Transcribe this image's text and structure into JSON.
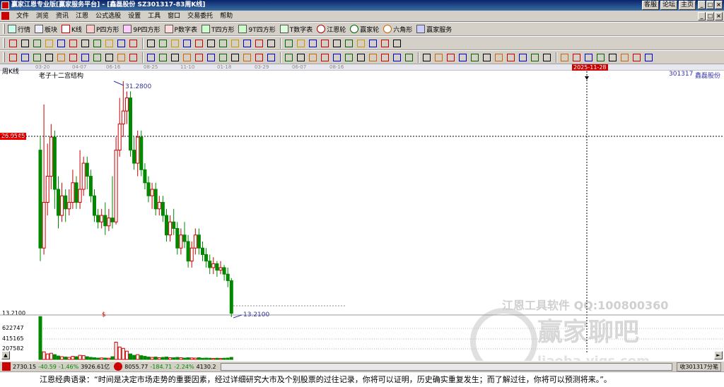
{
  "window": {
    "title": "赢家江恩专业版[赢家服务平台] - [鑫磊股份  SZ301317-83周K线]",
    "links": [
      "客服",
      "论坛",
      "主页"
    ]
  },
  "menu": [
    "文件",
    "浏览",
    "资讯",
    "江恩",
    "公式选股",
    "设置",
    "工具",
    "窗口",
    "交易委托",
    "帮助"
  ],
  "toolbar1": [
    "行情",
    "板块",
    "K线",
    "P四方形",
    "9P四方形",
    "P数字表",
    "T四方形",
    "9T四方形",
    "T数字表",
    "江恩轮",
    "赢家轮",
    "六角形",
    "赢家服务"
  ],
  "chart": {
    "period_label": "周K线",
    "structure_label": "老子十二宫结构",
    "code": "301317",
    "name": "鑫磊股份",
    "cursor_date": "2025-11-28",
    "cursor_price": "26.9545",
    "high_label": "31.2800",
    "low_label": "13.2100",
    "low_axis_label": "13.2100",
    "marker": "$",
    "top_dates": [
      "03-20",
      "04-07",
      "06-16",
      "08-25",
      "11-10",
      "01-18",
      "03-29",
      "06-07",
      "08-16"
    ],
    "vol_labels": [
      "622747",
      "415165",
      "207582"
    ],
    "candles": [
      {
        "o": 26,
        "c": 18.5,
        "h": 27,
        "l": 17.5
      },
      {
        "o": 18.5,
        "c": 22,
        "h": 29.5,
        "l": 18
      },
      {
        "o": 22,
        "c": 24,
        "h": 26.5,
        "l": 21
      },
      {
        "o": 24,
        "c": 27,
        "h": 28,
        "l": 23
      },
      {
        "o": 27,
        "c": 23,
        "h": 27.5,
        "l": 21.5
      },
      {
        "o": 23,
        "c": 21,
        "h": 24,
        "l": 20
      },
      {
        "o": 21,
        "c": 22.5,
        "h": 23.5,
        "l": 20.5
      },
      {
        "o": 22.5,
        "c": 21.5,
        "h": 23,
        "l": 20.5
      },
      {
        "o": 21.5,
        "c": 22,
        "h": 23,
        "l": 21
      },
      {
        "o": 22,
        "c": 23.5,
        "h": 24.5,
        "l": 21.5
      },
      {
        "o": 23.5,
        "c": 22,
        "h": 24,
        "l": 21.5
      },
      {
        "o": 22,
        "c": 23,
        "h": 26,
        "l": 21.5
      },
      {
        "o": 23,
        "c": 25,
        "h": 25.5,
        "l": 22.5
      },
      {
        "o": 25,
        "c": 24,
        "h": 25.5,
        "l": 23
      },
      {
        "o": 24,
        "c": 22.5,
        "h": 24.5,
        "l": 22
      },
      {
        "o": 22.5,
        "c": 21,
        "h": 23,
        "l": 20.5
      },
      {
        "o": 21,
        "c": 20.5,
        "h": 21.5,
        "l": 20
      },
      {
        "o": 20.5,
        "c": 21,
        "h": 21.5,
        "l": 20
      },
      {
        "o": 21,
        "c": 20.2,
        "h": 22,
        "l": 19.5
      },
      {
        "o": 20.2,
        "c": 20.8,
        "h": 21.5,
        "l": 19.8
      },
      {
        "o": 20.8,
        "c": 20.5,
        "h": 24,
        "l": 20
      },
      {
        "o": 20.5,
        "c": 26,
        "h": 27,
        "l": 20.3
      },
      {
        "o": 26,
        "c": 28,
        "h": 30,
        "l": 25.5
      },
      {
        "o": 28,
        "c": 29,
        "h": 31.28,
        "l": 27
      },
      {
        "o": 29,
        "c": 30,
        "h": 30.5,
        "l": 28
      },
      {
        "o": 30,
        "c": 26,
        "h": 30.5,
        "l": 25.5
      },
      {
        "o": 26,
        "c": 25,
        "h": 27,
        "l": 24.5
      },
      {
        "o": 25,
        "c": 27,
        "h": 27.5,
        "l": 24
      },
      {
        "o": 27,
        "c": 24.5,
        "h": 27.5,
        "l": 24
      },
      {
        "o": 24.5,
        "c": 23.5,
        "h": 25,
        "l": 23
      },
      {
        "o": 23.5,
        "c": 22.5,
        "h": 24,
        "l": 22
      },
      {
        "o": 22.5,
        "c": 23,
        "h": 23.5,
        "l": 21.5
      },
      {
        "o": 23,
        "c": 21.5,
        "h": 23.5,
        "l": 21
      },
      {
        "o": 21.5,
        "c": 22,
        "h": 22.5,
        "l": 21
      },
      {
        "o": 22,
        "c": 21,
        "h": 22.5,
        "l": 20.5
      },
      {
        "o": 21,
        "c": 19.5,
        "h": 21.5,
        "l": 19
      },
      {
        "o": 19.5,
        "c": 20.5,
        "h": 21,
        "l": 19
      },
      {
        "o": 20.5,
        "c": 20,
        "h": 21.5,
        "l": 19.5
      },
      {
        "o": 20,
        "c": 18.5,
        "h": 20.5,
        "l": 18
      },
      {
        "o": 18.5,
        "c": 19.5,
        "h": 20,
        "l": 18
      },
      {
        "o": 19.5,
        "c": 19,
        "h": 20.5,
        "l": 18.5
      },
      {
        "o": 19,
        "c": 17.5,
        "h": 19.5,
        "l": 17
      },
      {
        "o": 17.5,
        "c": 18.5,
        "h": 19,
        "l": 17
      },
      {
        "o": 18.5,
        "c": 19.5,
        "h": 20,
        "l": 18
      },
      {
        "o": 19.5,
        "c": 18.5,
        "h": 20,
        "l": 18
      },
      {
        "o": 18.5,
        "c": 18,
        "h": 19,
        "l": 17.5
      },
      {
        "o": 18,
        "c": 17.5,
        "h": 18.5,
        "l": 17
      },
      {
        "o": 17.5,
        "c": 17,
        "h": 18,
        "l": 16.5
      },
      {
        "o": 17,
        "c": 17.3,
        "h": 17.8,
        "l": 16.5
      },
      {
        "o": 17.3,
        "c": 16.8,
        "h": 17.5,
        "l": 16.3
      },
      {
        "o": 16.8,
        "c": 17,
        "h": 17.5,
        "l": 16.5
      },
      {
        "o": 17,
        "c": 16.5,
        "h": 17.2,
        "l": 16
      },
      {
        "o": 16.5,
        "c": 16,
        "h": 17,
        "l": 15.5
      },
      {
        "o": 16,
        "c": 13.5,
        "h": 16.2,
        "l": 13.21
      }
    ],
    "volumes": [
      620000,
      110000,
      80000,
      90000,
      70000,
      50000,
      40000,
      35000,
      30000,
      45000,
      40000,
      60000,
      55000,
      40000,
      30000,
      25000,
      20000,
      22000,
      20000,
      18000,
      40000,
      250000,
      180000,
      160000,
      120000,
      80000,
      60000,
      70000,
      55000,
      45000,
      35000,
      30000,
      35000,
      25000,
      30000,
      35000,
      25000,
      25000,
      30000,
      25000,
      20000,
      25000,
      22000,
      20000,
      25000,
      18000,
      20000,
      18000,
      15000,
      18000,
      15000,
      18000,
      20000,
      30000
    ]
  },
  "status": {
    "idx1_val": "2730.15",
    "idx1_chg": "-40.59",
    "idx1_pct": "-1.46%",
    "idx1_amt": "3926.61亿",
    "idx2_val": "8055.77",
    "idx2_chg": "-184.71",
    "idx2_pct": "-2.24%",
    "idx2_amt": "4130.2",
    "right": "收301317分笔"
  },
  "quote": "江恩经典语录：“时间是决定市场走势的重要因素，经过详细研究大市及个别股票的过往记录，你将可以证明，历史确实重复发生；而了解过往，你将可以预测将来。”。",
  "watermark": {
    "line1": "江恩工具软件  QQ:100800360",
    "line2": "赢家聊吧",
    "line3": "liaoba.yjgs.com"
  }
}
